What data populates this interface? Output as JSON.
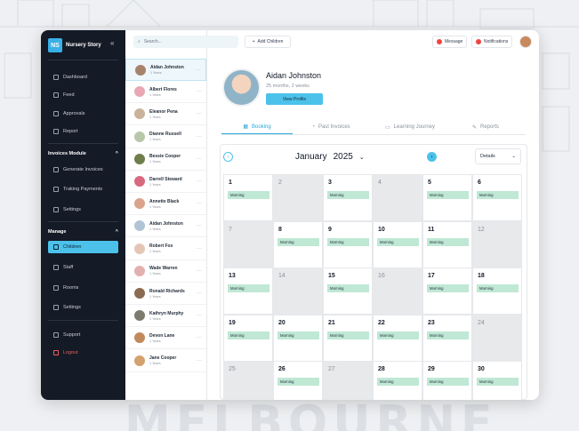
{
  "background_word": "MELBOURNE",
  "brand": {
    "initials": "NS",
    "name": "Nursery Story"
  },
  "sidebar": {
    "items": [
      {
        "label": "Dashboard",
        "icon": "dashboard-icon"
      },
      {
        "label": "Feed",
        "icon": "feed-icon"
      },
      {
        "label": "Approvals",
        "icon": "approvals-icon"
      },
      {
        "label": "Report",
        "icon": "report-icon"
      }
    ],
    "invoices_heading": "Invoices Module",
    "invoices_items": [
      {
        "label": "Generate Invoices",
        "icon": "invoice-icon"
      },
      {
        "label": "Traking Payments",
        "icon": "payments-icon"
      },
      {
        "label": "Settings",
        "icon": "settings-icon"
      }
    ],
    "manage_heading": "Manage",
    "manage_items": [
      {
        "label": "Children",
        "icon": "children-icon",
        "active": true
      },
      {
        "label": "Staff",
        "icon": "staff-icon"
      },
      {
        "label": "Rooms",
        "icon": "rooms-icon"
      },
      {
        "label": "Settings",
        "icon": "settings-icon"
      }
    ],
    "support": "Support",
    "logout": "Logout"
  },
  "search": {
    "placeholder": "Search..."
  },
  "toolbar": {
    "add_children": "Add Children",
    "message": "Message",
    "notifications": "Notifications"
  },
  "children": [
    {
      "name": "Aidan Johnston",
      "age": "1 Years",
      "color": "#a7836b",
      "selected": true
    },
    {
      "name": "Albert Flores",
      "age": "1 Years",
      "color": "#e8a7b3"
    },
    {
      "name": "Eleanor Pena",
      "age": "1 Years",
      "color": "#c9b39a"
    },
    {
      "name": "Dianne Russell",
      "age": "1 Years",
      "color": "#b8c7a9"
    },
    {
      "name": "Bessie Cooper",
      "age": "1 Years",
      "color": "#6f7d4c"
    },
    {
      "name": "Darrell Steward",
      "age": "1 Years",
      "color": "#d86a80"
    },
    {
      "name": "Annette Black",
      "age": "1 Years",
      "color": "#d9a48b"
    },
    {
      "name": "Aidan Johnston",
      "age": "1 Years",
      "color": "#b0c4d6"
    },
    {
      "name": "Robert Fox",
      "age": "1 Years",
      "color": "#e5c6b5"
    },
    {
      "name": "Wade Warren",
      "age": "1 Years",
      "color": "#e3b0b0"
    },
    {
      "name": "Ronald Richards",
      "age": "1 Years",
      "color": "#8a6b52"
    },
    {
      "name": "Kathryn Murphy",
      "age": "1 Years",
      "color": "#7d7a70"
    },
    {
      "name": "Devon Lane",
      "age": "1 Years",
      "color": "#c08a5c"
    },
    {
      "name": "Jane Cooper",
      "age": "1 Years",
      "color": "#d3a26e"
    }
  ],
  "profile": {
    "name": "Aidan Johnston",
    "age": "25 months, 2 weeks",
    "view_button": "View Profile"
  },
  "tabs": [
    "Booking",
    "Past Invoices",
    "Learning Journey",
    "Reports"
  ],
  "calendar": {
    "month": "January",
    "year": "2025",
    "view": "Details",
    "session_label": "Morning",
    "days": [
      {
        "d": "1",
        "s": true
      },
      {
        "d": "2",
        "g": true
      },
      {
        "d": "3",
        "s": true
      },
      {
        "d": "4",
        "g": true
      },
      {
        "d": "5",
        "s": true
      },
      {
        "d": "6",
        "s": true
      },
      {
        "d": "7",
        "g": true
      },
      {
        "d": "8",
        "s": true
      },
      {
        "d": "9",
        "s": true
      },
      {
        "d": "10",
        "s": true
      },
      {
        "d": "11",
        "s": true
      },
      {
        "d": "12",
        "g": true
      },
      {
        "d": "13",
        "s": true
      },
      {
        "d": "14",
        "g": true
      },
      {
        "d": "15",
        "s": true
      },
      {
        "d": "16",
        "g": true
      },
      {
        "d": "17",
        "s": true
      },
      {
        "d": "18",
        "s": true
      },
      {
        "d": "19",
        "s": true
      },
      {
        "d": "20",
        "s": true
      },
      {
        "d": "21",
        "s": true
      },
      {
        "d": "22",
        "s": true
      },
      {
        "d": "23",
        "s": true
      },
      {
        "d": "24",
        "g": true
      },
      {
        "d": "25",
        "g": true
      },
      {
        "d": "26",
        "s": true
      },
      {
        "d": "27",
        "g": true
      },
      {
        "d": "28",
        "s": true
      },
      {
        "d": "29",
        "s": true
      },
      {
        "d": "30",
        "s": true
      }
    ]
  },
  "colors": {
    "accent": "#4cc2ea",
    "sidebar": "#141a26",
    "session": "#bfe8d5",
    "grey_day": "#e8e9eb"
  }
}
